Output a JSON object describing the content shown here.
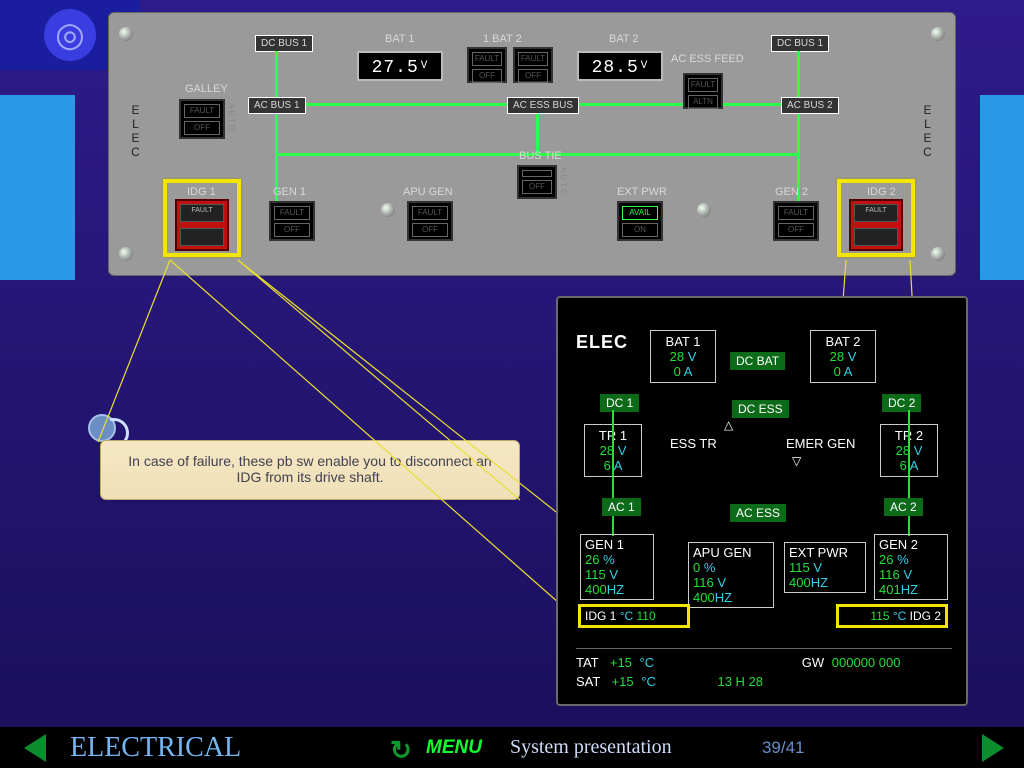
{
  "logo_glyph": "◎",
  "panel": {
    "elec_label": "E L E C",
    "dcbus1": "DC BUS 1",
    "bat1_label": "BAT 1",
    "bat_mid": "1   BAT   2",
    "bat2_label": "BAT 2",
    "acessfeed": "AC ESS FEED",
    "galley": "GALLEY",
    "acbus1": "AC BUS 1",
    "acessbus": "AC ESS BUS",
    "acbus2": "AC BUS 2",
    "bustie_label": "BUS TIE",
    "idg1": "IDG 1",
    "gen1": "GEN 1",
    "apugen": "APU GEN",
    "extpwr": "EXT PWR",
    "gen2": "GEN 2",
    "idg2": "IDG 2",
    "auto": "AUTO",
    "bat1_val": "27.5",
    "bat2_val": "28.5",
    "volt_unit": "V",
    "pb": {
      "fault": "FAULT",
      "off": "OFF",
      "altn": "ALTN",
      "avail": "AVAIL",
      "on": "ON"
    }
  },
  "callout_text": "In case of failure, these pb sw enable you to disconnect an IDG from its drive shaft.",
  "ecam": {
    "title": "ELEC",
    "bat1": {
      "name": "BAT 1",
      "v": "28",
      "a": "0"
    },
    "bat2": {
      "name": "BAT 2",
      "v": "28",
      "a": "0"
    },
    "dcbat": "DC BAT",
    "dc1": "DC 1",
    "dc2": "DC 2",
    "dcess": "DC ESS",
    "tr1": {
      "name": "TR 1",
      "v": "28",
      "a": "6"
    },
    "tr2": {
      "name": "TR 2",
      "v": "28",
      "a": "6"
    },
    "esstr": "ESS TR",
    "emergen": "EMER GEN",
    "ac1": "AC 1",
    "acess": "AC ESS",
    "ac2": "AC 2",
    "gen1": {
      "name": "GEN 1",
      "pct": "26",
      "v": "115",
      "hz": "400"
    },
    "gen2": {
      "name": "GEN 2",
      "pct": "26",
      "v": "116",
      "hz": "401"
    },
    "apugen": {
      "name": "APU GEN",
      "pct": "0",
      "v": "116",
      "hz": "400"
    },
    "extpwr": {
      "name": "EXT PWR",
      "v": "115",
      "hz": "400"
    },
    "idg1_label": "IDG 1",
    "idg1_temp": "110",
    "idg2_label": "IDG 2",
    "idg2_temp": "115",
    "tc_unit": "°C",
    "pct_unit": "%",
    "v_unit": "V",
    "a_unit": "A",
    "hz_unit": "HZ",
    "tat_label": "TAT",
    "tat_val": "+15",
    "tat_unit": "°C",
    "sat_label": "SAT",
    "sat_val": "+15",
    "sat_unit": "°C",
    "time": "13 H 28",
    "gw_label": "GW",
    "gw_val": "000000 000",
    "tri_up": "△",
    "tri_dn": "▽"
  },
  "footer": {
    "section": "ELECTRICAL",
    "menu": "MENU",
    "subtitle": "System presentation",
    "page": "39/41",
    "refresh": "↻"
  }
}
